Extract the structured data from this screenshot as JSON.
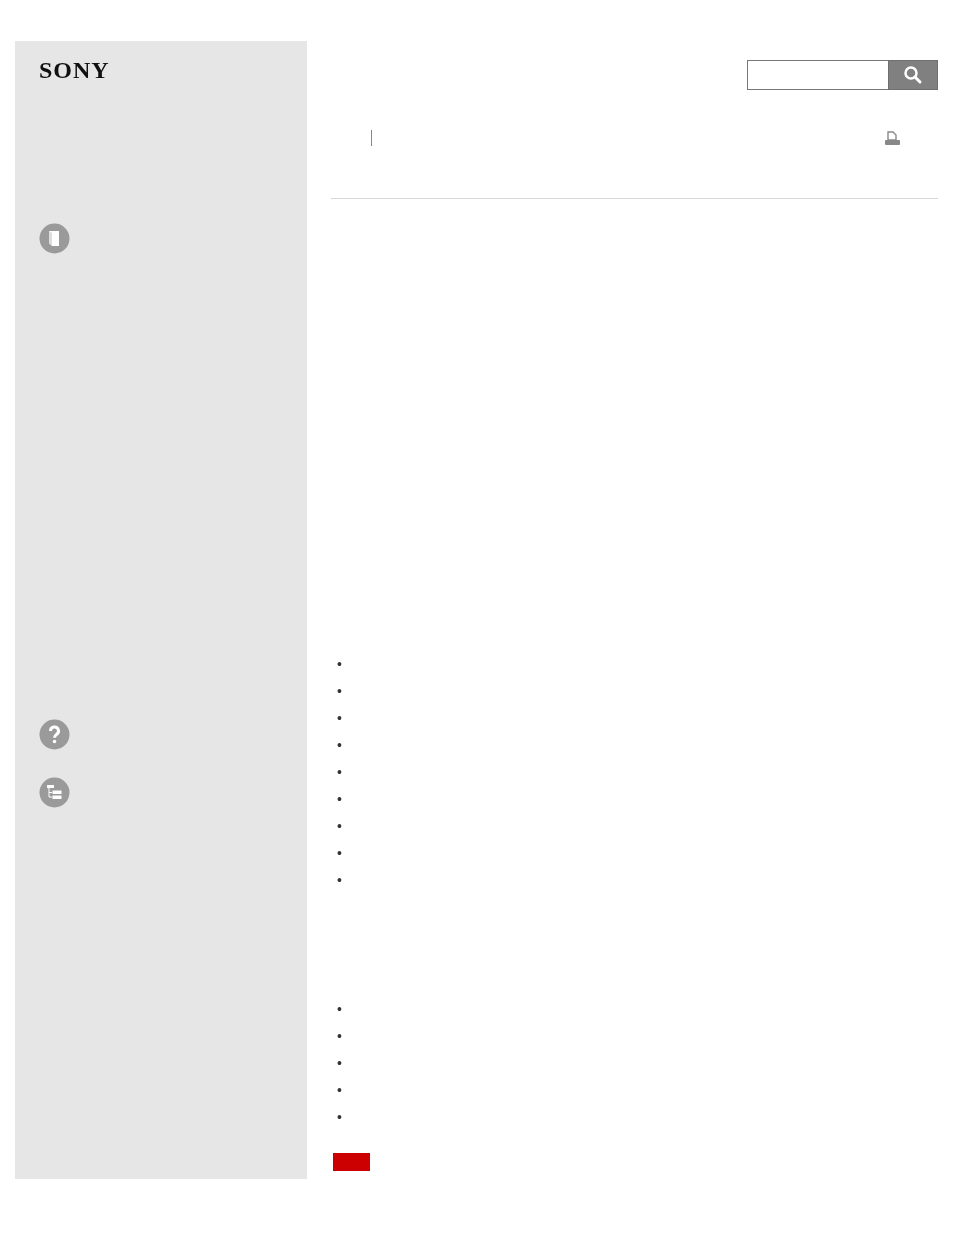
{
  "sidebar": {
    "logo": "SONY"
  },
  "bullet_lists": [
    {
      "items": [
        {
          "marker": "•"
        },
        {
          "marker": "•"
        },
        {
          "marker": "•"
        },
        {
          "marker": "•"
        },
        {
          "marker": "•"
        },
        {
          "marker": "•"
        },
        {
          "marker": "•"
        },
        {
          "marker": "•"
        },
        {
          "marker": "•"
        }
      ]
    },
    {
      "items": [
        {
          "marker": "•"
        },
        {
          "marker": "•"
        },
        {
          "marker": "•"
        },
        {
          "marker": "•"
        },
        {
          "marker": "•"
        }
      ]
    }
  ]
}
